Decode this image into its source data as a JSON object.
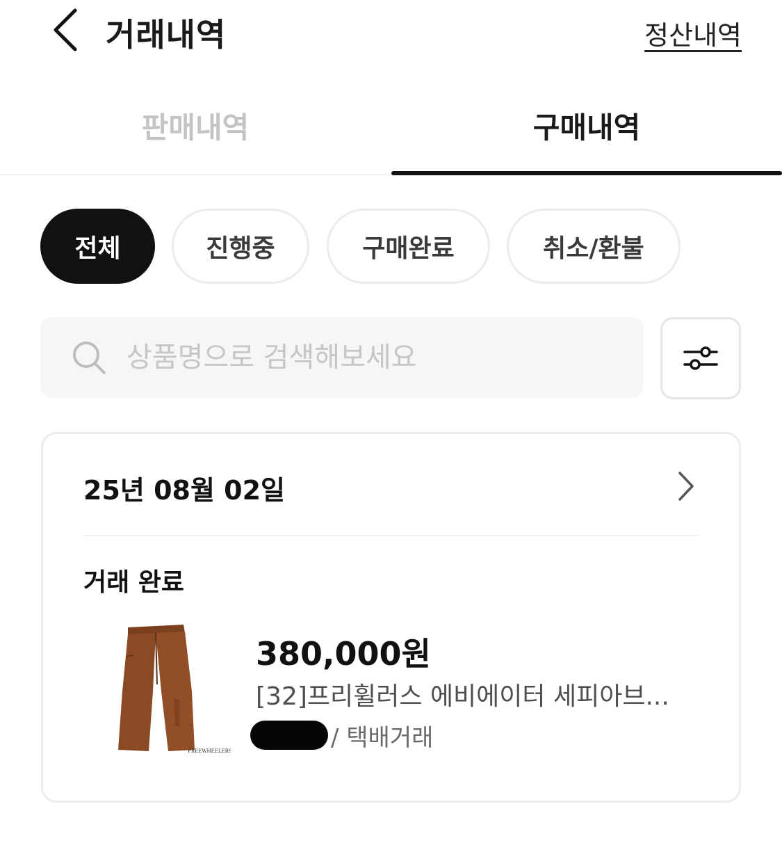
{
  "header": {
    "title": "거래내역",
    "settlement_link": "정산내역"
  },
  "tabs": [
    {
      "label": "판매내역",
      "active": false
    },
    {
      "label": "구매내역",
      "active": true
    }
  ],
  "filters": [
    {
      "label": "전체",
      "active": true
    },
    {
      "label": "진행중",
      "active": false
    },
    {
      "label": "구매완료",
      "active": false
    },
    {
      "label": "취소/환불",
      "active": false
    }
  ],
  "search": {
    "placeholder": "상품명으로 검색해보세요",
    "value": ""
  },
  "transaction": {
    "date": "25년 08월 02일",
    "status": "거래 완료",
    "price": "380,000원",
    "product_name": "[32]프리휠러스 에비에이터 세피아브...",
    "delivery_method": "/ 택배거래",
    "thumbnail_caption": "FREEWHEELERS & COMPANY"
  },
  "colors": {
    "active_chip_bg": "#111111",
    "inactive_tab_text": "#c4c4c4",
    "pants_brown": "#8a4a24"
  },
  "icons": {
    "back": "chevron-left-icon",
    "search": "search-icon",
    "filter": "sliders-icon",
    "detail": "chevron-right-icon"
  }
}
